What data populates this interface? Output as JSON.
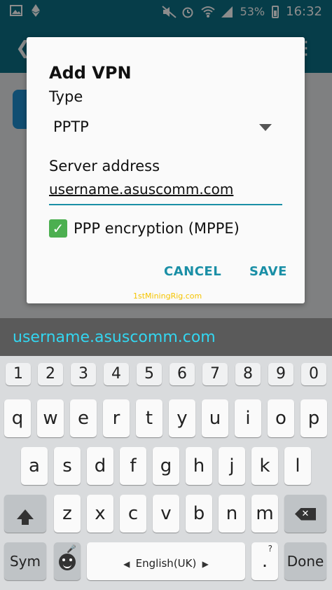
{
  "status_bar": {
    "battery_percent": "53%",
    "time": "16:32",
    "icons": [
      "gallery-icon",
      "ethereum-icon",
      "mute-icon",
      "alarm-icon",
      "wifi-icon",
      "signal-icon",
      "battery-icon"
    ]
  },
  "dialog": {
    "title": "Add VPN",
    "type_label": "Type",
    "type_value": "PPTP",
    "server_label": "Server address",
    "server_value": "username.asuscomm.com",
    "encryption_label": "PPP encryption (MPPE)",
    "encryption_checked": true,
    "cancel_label": "CANCEL",
    "save_label": "SAVE"
  },
  "watermark": "1stMiningRig.com",
  "suggestion": "username.asuscomm.com",
  "keyboard": {
    "numbers": [
      "1",
      "2",
      "3",
      "4",
      "5",
      "6",
      "7",
      "8",
      "9",
      "0"
    ],
    "row1": [
      "q",
      "w",
      "e",
      "r",
      "t",
      "y",
      "u",
      "i",
      "o",
      "p"
    ],
    "row2": [
      "a",
      "s",
      "d",
      "f",
      "g",
      "h",
      "j",
      "k",
      "l"
    ],
    "row3": [
      "z",
      "x",
      "c",
      "v",
      "b",
      "n",
      "m"
    ],
    "sym_label": "Sym",
    "space_label": "English(UK)",
    "period_label": ".",
    "period_hint": "?",
    "done_label": "Done"
  },
  "colors": {
    "accent": "#1a8fa6",
    "status_bar": "#0b6f85",
    "checkbox": "#4caf50",
    "suggestion_text": "#33d6f0",
    "watermark": "#f5c400"
  }
}
